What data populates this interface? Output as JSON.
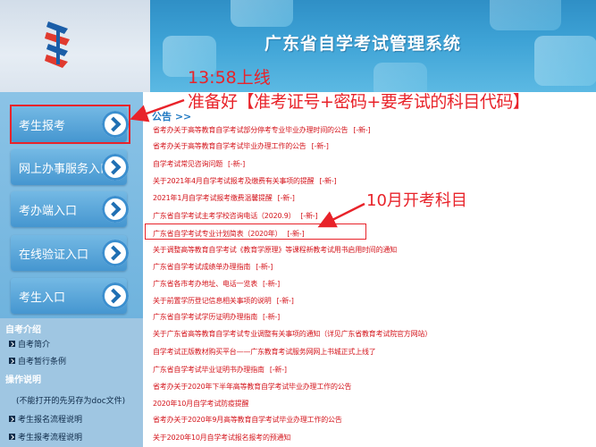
{
  "header": {
    "title": "广东省自学考试管理系统"
  },
  "sidebar": {
    "items": [
      {
        "label": "考生报考"
      },
      {
        "label": "网上办事服务入口"
      },
      {
        "label": "考办端入口"
      },
      {
        "label": "在线验证入口"
      },
      {
        "label": "考生入口"
      }
    ],
    "sections": [
      {
        "title": "自考介绍",
        "links": [
          "自考简介",
          "自考暂行条例"
        ]
      },
      {
        "title": "操作说明",
        "links": [
          "(不能打开的先另存为doc文件)",
          "考生报名流程说明",
          "考生报考流程说明"
        ]
      }
    ]
  },
  "main": {
    "notice_header": "公告 >>",
    "new_tag": "[-新-]",
    "notices": [
      "省考办关于高等教育自学考试部分停考专业毕业办理时间的公告",
      "省考办关于高等教育自学考试毕业办理工作的公告",
      "自学考试常见咨询问题",
      "关于2021年4月自学考试报考及缴费有关事项的提醒",
      "2021年1月自学考试报考缴费温馨提醒",
      "广东省自学考试主考学校咨询电话（2020.9）",
      "广东省自学考试专业计划简表（2020年）",
      "关于调整高等教育自学考试《教育学原理》等课程新教考试用书启用时间的通知",
      "广东省自学考试成绩单办理指南",
      "广东省各市考办地址、电话一览表",
      "关于前置学历登记信息相关事项的说明",
      "广东省自学考试学历证明办理指南",
      "关于广东省高等教育自学考试专业调整有关事项的通知（详见广东省教育考试院官方网站）",
      "自学考试正版教材购买平台——广东教育考试服务网网上书城正式上线了",
      "广东省自学考试毕业证明书办理指南",
      "省考办关于2020年下半年高等教育自学考试毕业办理工作的公告",
      "2020年10月自学考试防疫提醒",
      "省考办关于2020年9月高等教育自学考试毕业办理工作的公告",
      "关于2020年10月自学考试报名报考的预通知"
    ],
    "notice_new_flags": [
      true,
      true,
      true,
      true,
      true,
      true,
      true,
      false,
      true,
      true,
      true,
      true,
      false,
      false,
      true,
      false,
      false,
      false,
      false
    ]
  },
  "annotations": {
    "time": "13:58上线",
    "prepare": "准备好【准考证号+密码+要考试的科目代码】",
    "october": "10月开考科目"
  },
  "colors": {
    "banner_blue": "#3ea3d6",
    "sidebar_blue": "#5faad9",
    "notice_red": "#d4151c",
    "annotation_red": "#e8232a",
    "link_blue": "#1e78c2"
  }
}
